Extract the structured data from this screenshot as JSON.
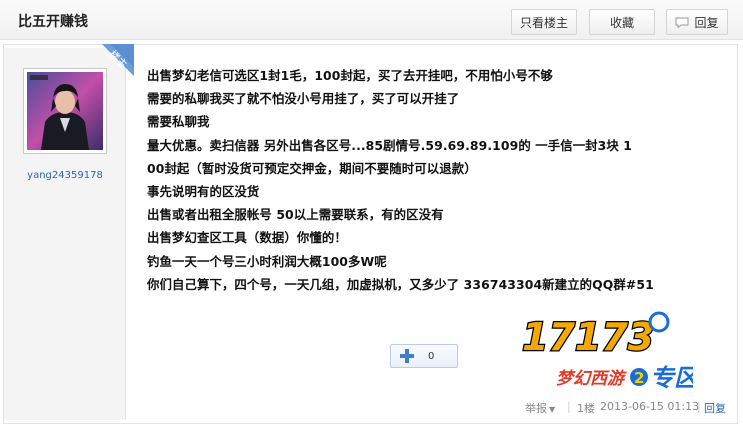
{
  "header": {
    "title": "比五开赚钱",
    "only_author_label": "只看楼主",
    "favorite_label": "收藏",
    "reply_label": "回复"
  },
  "author": {
    "username": "yang24359178",
    "badge": "楼主"
  },
  "post": {
    "lines": [
      "出售梦幻老信可选区1封1毛，100封起，买了去开挂吧，不用怕小号不够",
      "需要的私聊我买了就不怕没小号用挂了，买了可以开挂了",
      "需要私聊我",
      "量大优惠。卖扫信器 另外出售各区号...85剧情号.59.69.89.109的 一手信一封3块 1",
      "00封起（暂时没货可预定交押金，期间不要随时可以退款）",
      "事先说明有的区没货",
      "出售或者出租全服帐号 50以上需要联系，有的区没有",
      "出售梦幻查区工具（数据）你懂的！",
      "钓鱼一天一个号三小时利润大概100多W呢",
      "你们自己算下，四个号，一天几组，加虚拟机，又多少了 336743304新建立的QQ群#51"
    ],
    "logo_text": "17173",
    "logo_subtitle": "梦幻西游",
    "logo_num": "2",
    "logo_zone": "专区"
  },
  "vote": {
    "count": "0"
  },
  "footer": {
    "report_label": "举报",
    "sep": "|",
    "floor": "1楼",
    "datetime": "2013-06-15 01:13",
    "reply_label": "回复"
  },
  "colors": {
    "link": "#2d64b3",
    "ribbon": "#5b8fd2",
    "logo_orange": "#f5a800",
    "logo_blue": "#1a6dd9"
  }
}
